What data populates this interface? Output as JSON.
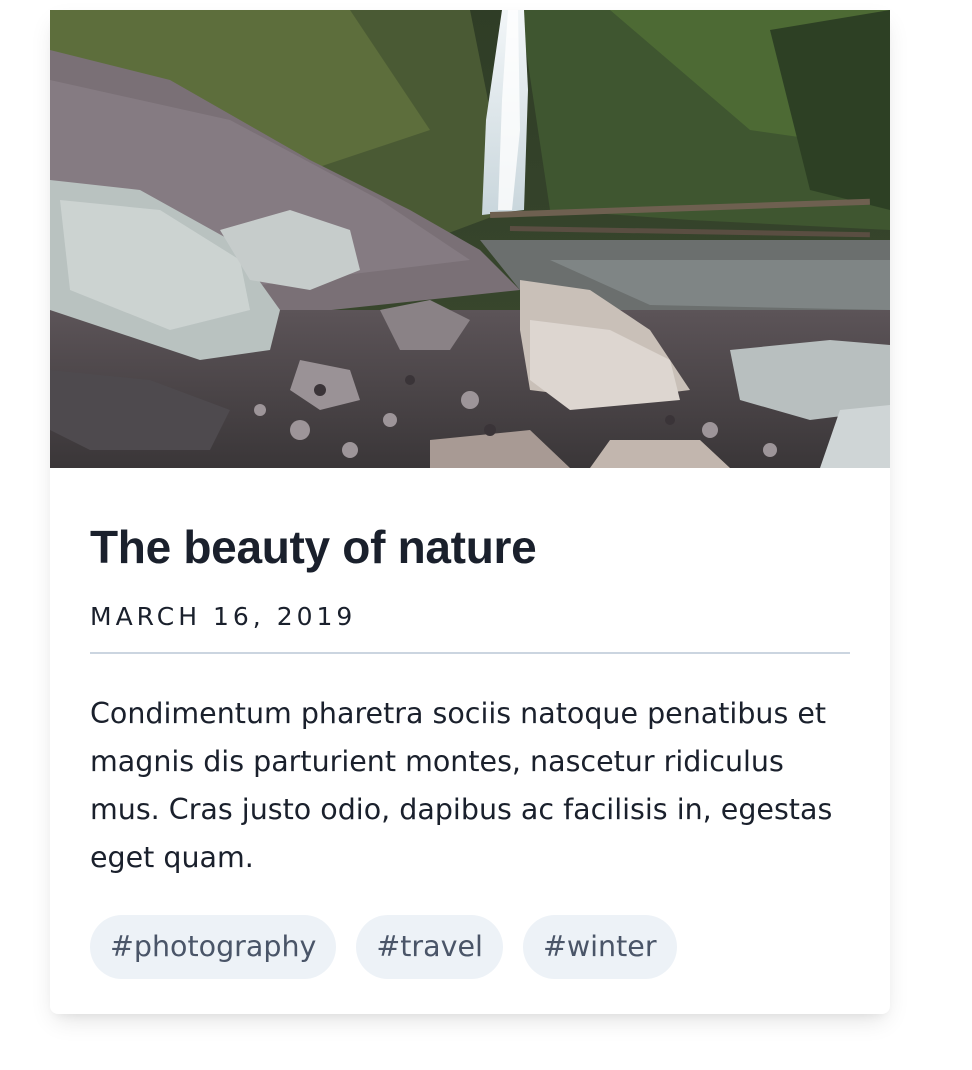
{
  "card": {
    "image": {
      "subject": "waterfall-in-rocky-gorge-photo"
    },
    "title": "The beauty of nature",
    "date": "MARCH 16, 2019",
    "body": "Condimentum pharetra sociis natoque penatibus et magnis dis parturient montes, nascetur ridiculus mus. Cras justo odio, dapibus ac facilisis in, egestas eget quam.",
    "tags": [
      "#photography",
      "#travel",
      "#winter"
    ]
  },
  "colors": {
    "title": "#1a202c",
    "divider": "#cbd5e0",
    "tag_bg": "#edf2f7",
    "tag_text": "#4a5568"
  }
}
